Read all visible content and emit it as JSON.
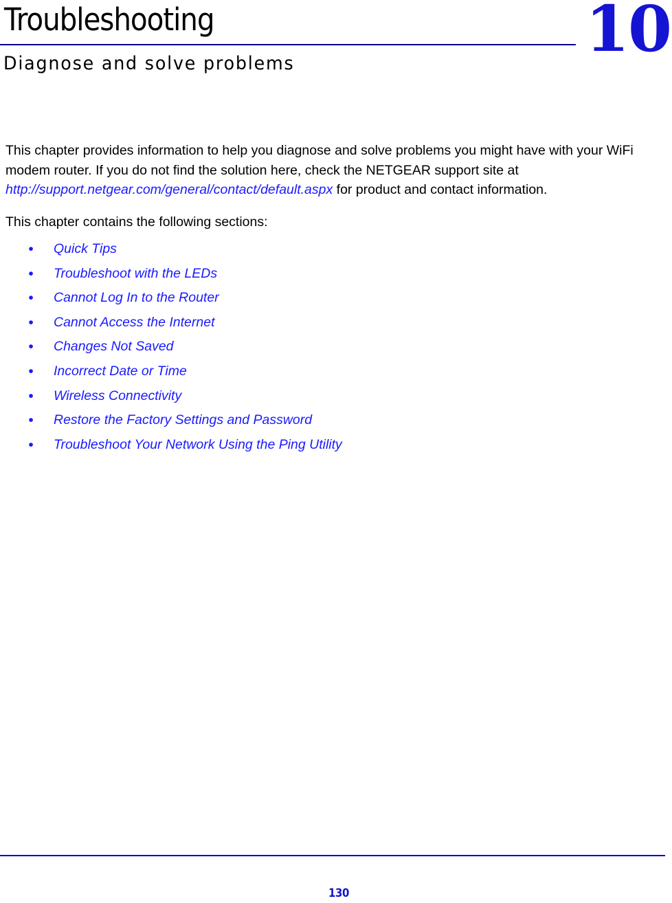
{
  "chapter": {
    "title": "Troubleshooting",
    "subtitle": "Diagnose and solve problems",
    "number": "10"
  },
  "body": {
    "intro_part1": "This chapter provides information to help you diagnose and solve problems you might have with your WiFi modem router. If you do not find the solution here, check the NETGEAR support site at ",
    "intro_link": "http://support.netgear.com/general/contact/default.aspx",
    "intro_part2": " for product and contact information.",
    "sections_intro": "This chapter contains the following sections:"
  },
  "section_links": [
    {
      "bullet": "•",
      "label": "Quick Tips"
    },
    {
      "bullet": "•",
      "label": "Troubleshoot with the LEDs"
    },
    {
      "bullet": "•",
      "label": "Cannot Log In to the Router"
    },
    {
      "bullet": "•",
      "label": "Cannot Access the Internet"
    },
    {
      "bullet": "•",
      "label": "Changes Not Saved"
    },
    {
      "bullet": "•",
      "label": "Incorrect Date or Time"
    },
    {
      "bullet": "•",
      "label": "Wireless Connectivity"
    },
    {
      "bullet": "•",
      "label": "Restore the Factory Settings and Password"
    },
    {
      "bullet": "•",
      "label": "Troubleshoot Your Network Using the Ping Utility"
    }
  ],
  "footer": {
    "page_number": "130"
  },
  "colors": {
    "link_blue": "#1a1aff",
    "chapter_number_blue": "#1414d2",
    "header_rule": "#00008f",
    "footer_rule": "#0000c8",
    "text": "#000000"
  }
}
